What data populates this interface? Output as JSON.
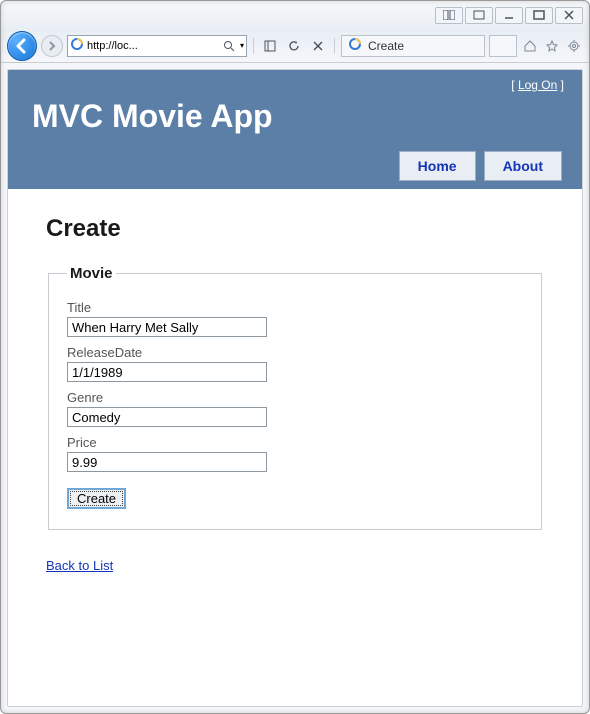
{
  "browser": {
    "url_display": "http://loc...",
    "search_hint": "",
    "tab_title": "Create"
  },
  "header": {
    "logon_label": "Log On",
    "app_title": "MVC Movie App",
    "nav": [
      {
        "label": "Home"
      },
      {
        "label": "About"
      }
    ]
  },
  "page": {
    "title": "Create",
    "fieldset_legend": "Movie",
    "fields": {
      "title_label": "Title",
      "title_value": "When Harry Met Sally",
      "release_label": "ReleaseDate",
      "release_value": "1/1/1989",
      "genre_label": "Genre",
      "genre_value": "Comedy",
      "price_label": "Price",
      "price_value": "9.99"
    },
    "submit_label": "Create",
    "back_link_label": "Back to List"
  }
}
